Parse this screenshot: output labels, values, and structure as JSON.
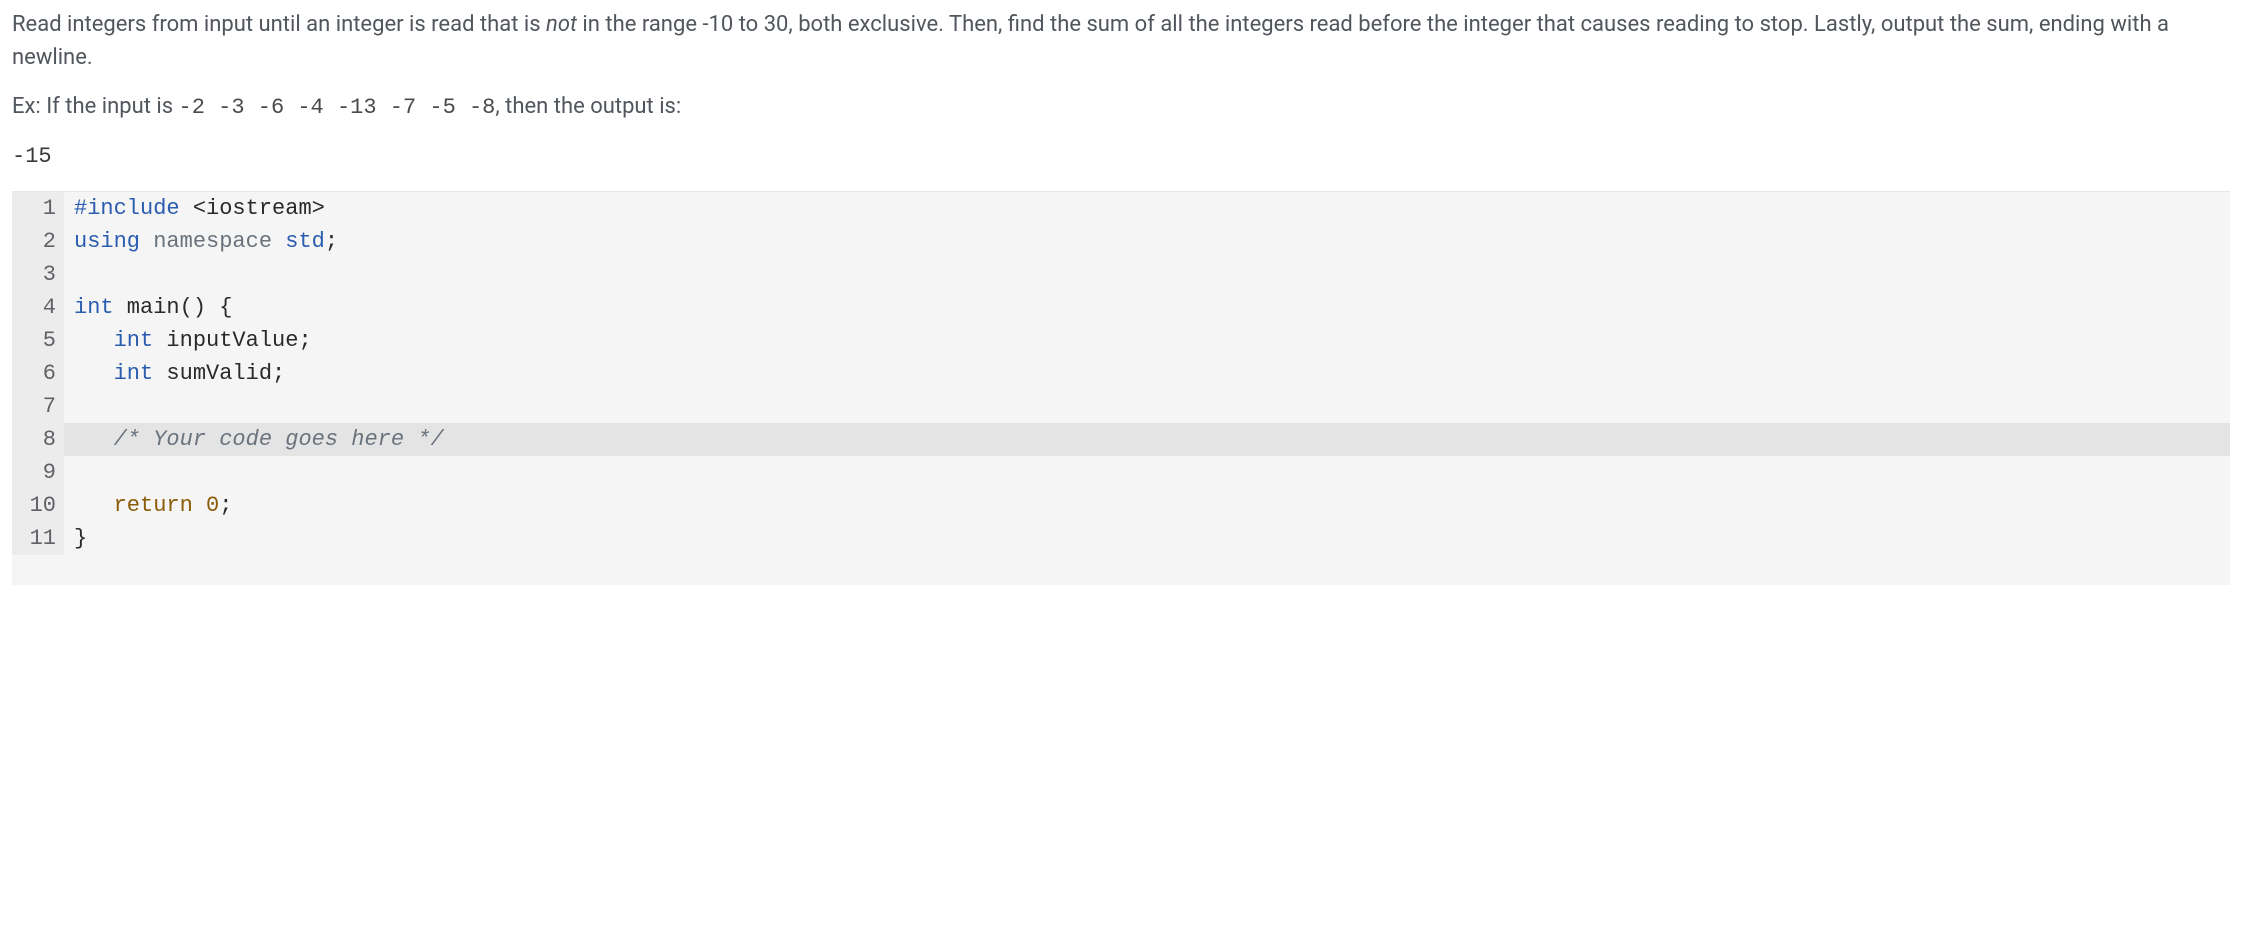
{
  "problem": {
    "text_before_em": "Read integers from input until an integer is read that is ",
    "em_word": "not",
    "text_after_em": " in the range -10 to 30, both exclusive. Then, find the sum of all the integers read before the integer that causes reading to stop. Lastly, output the sum, ending with a newline."
  },
  "example": {
    "prefix": "Ex: If the input is ",
    "input_values": "-2  -3  -6  -4  -13  -7  -5  -8",
    "suffix": ", then the output is:"
  },
  "output": "-15",
  "code": {
    "lines": [
      {
        "no": "1"
      },
      {
        "no": "2"
      },
      {
        "no": "3"
      },
      {
        "no": "4"
      },
      {
        "no": "5"
      },
      {
        "no": "6"
      },
      {
        "no": "7"
      },
      {
        "no": "8"
      },
      {
        "no": "9"
      },
      {
        "no": "10"
      },
      {
        "no": "11"
      }
    ],
    "tokens": {
      "l1_include": "#include",
      "l1_open": " <",
      "l1_iostream": "iostream",
      "l1_close": ">",
      "l2_using": "using",
      "l2_namespace": " namespace",
      "l2_std": " std",
      "l2_semi": ";",
      "l4_int": "int",
      "l4_main": " main",
      "l4_parens": "()",
      "l4_brace": " {",
      "l5_indent": "   ",
      "l5_int": "int",
      "l5_var": " inputValue",
      "l5_semi": ";",
      "l6_indent": "   ",
      "l6_int": "int",
      "l6_var": " sumValid",
      "l6_semi": ";",
      "l8_indent": "   ",
      "l8_comment": "/* Your code goes here */",
      "l10_indent": "   ",
      "l10_return": "return",
      "l10_zero": " 0",
      "l10_semi": ";",
      "l11_brace": "}"
    },
    "active_line": 8
  }
}
